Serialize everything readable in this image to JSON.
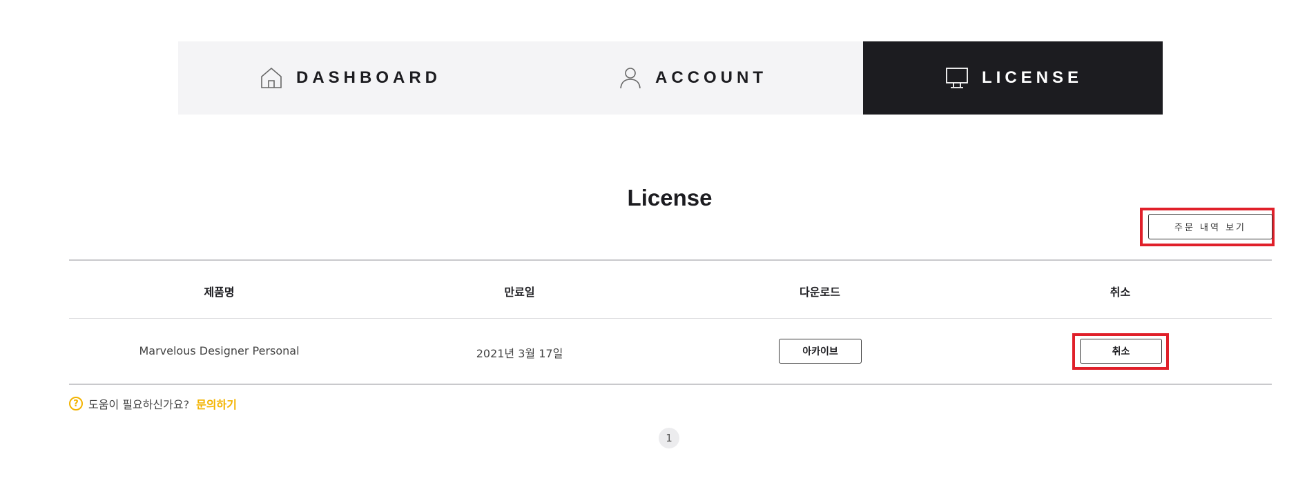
{
  "tabs": [
    {
      "label": "DASHBOARD",
      "icon": "home-icon",
      "active": false
    },
    {
      "label": "ACCOUNT",
      "icon": "user-icon",
      "active": false
    },
    {
      "label": "LICENSE",
      "icon": "monitor-icon",
      "active": true
    }
  ],
  "page": {
    "title": "License",
    "order_history_label": "주문 내역 보기"
  },
  "table": {
    "headers": [
      "제품명",
      "만료일",
      "다운로드",
      "취소"
    ],
    "rows": [
      {
        "product": "Marvelous Designer Personal",
        "expiry": "2021년 3월 17일",
        "download_label": "아카이브",
        "cancel_label": "취소"
      }
    ]
  },
  "help": {
    "question": "도움이 필요하신가요?",
    "link": "문의하기"
  },
  "pagination": {
    "current": "1"
  },
  "colors": {
    "accent": "#f3b300",
    "highlight": "#e0202a",
    "active_tab": "#1c1c20",
    "inactive_tab": "#f4f4f6"
  }
}
